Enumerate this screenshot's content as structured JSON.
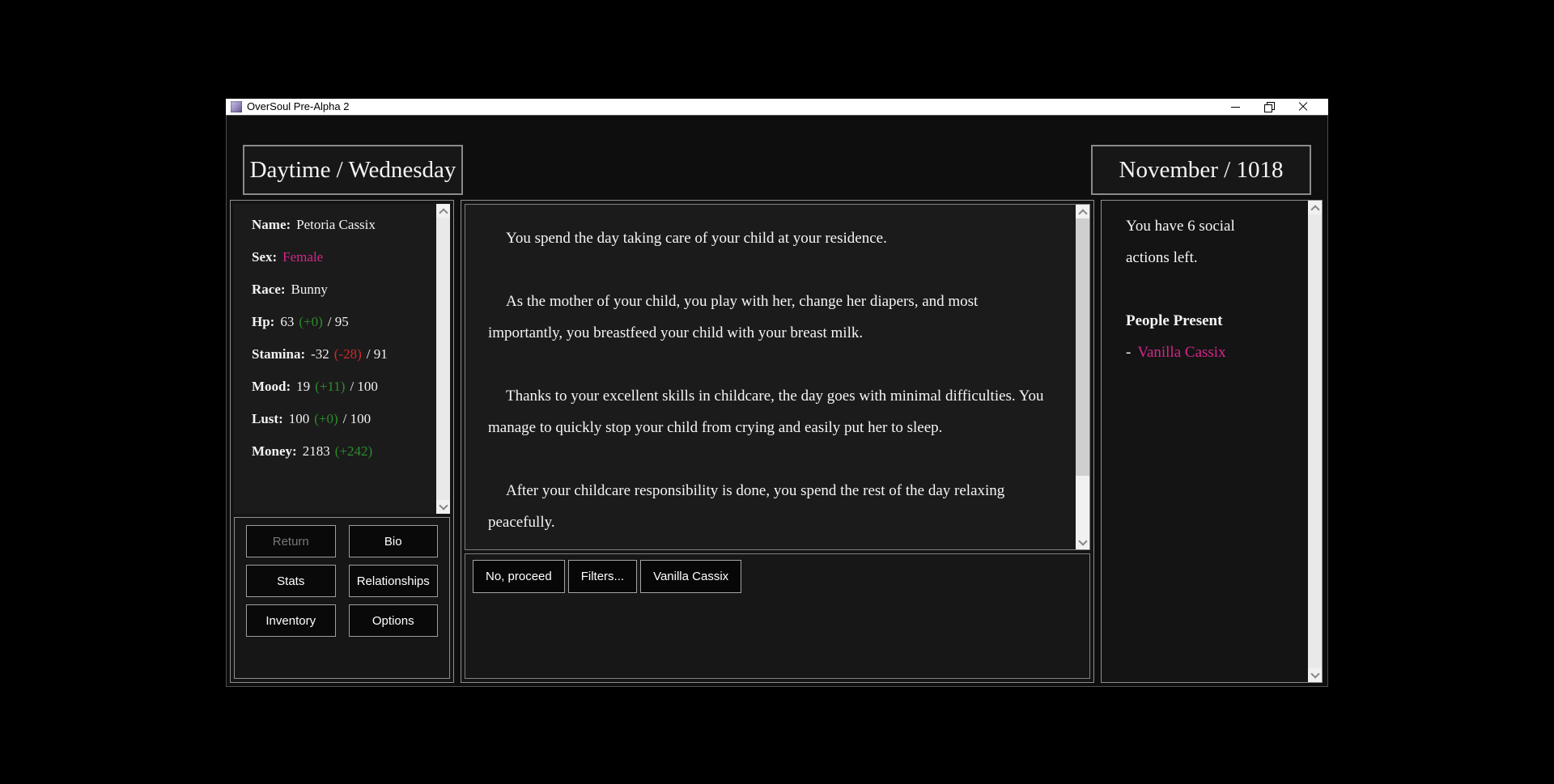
{
  "window": {
    "title": "OverSoul Pre-Alpha 2"
  },
  "header": {
    "daypart_weekday": "Daytime / Wednesday",
    "month_year": "November / 1018"
  },
  "colors": {
    "pink": "#d6258a",
    "green": "#2e8b2e",
    "red": "#cc2b2b",
    "disabled_gray": "#787878"
  },
  "stats": {
    "items": [
      {
        "label": "Name:",
        "value": "Petoria Cassix"
      },
      {
        "label": "Sex:",
        "value": "Female",
        "value_color": "#d6258a"
      },
      {
        "label": "Race:",
        "value": "Bunny"
      },
      {
        "label": "Hp:",
        "value": "63",
        "delta": "(+0)",
        "delta_color": "#2e8b2e",
        "suffix": "/ 95"
      },
      {
        "label": "Stamina:",
        "value": "-32",
        "delta": "(-28)",
        "delta_color": "#cc2b2b",
        "suffix": "/ 91"
      },
      {
        "label": "Mood:",
        "value": "19",
        "delta": "(+11)",
        "delta_color": "#2e8b2e",
        "suffix": "/ 100"
      },
      {
        "label": "Lust:",
        "value": "100",
        "delta": "(+0)",
        "delta_color": "#2e8b2e",
        "suffix": "/ 100"
      },
      {
        "label": "Money:",
        "value": "2183",
        "delta": "(+242)",
        "delta_color": "#2e8b2e",
        "suffix": ""
      }
    ]
  },
  "menu": {
    "buttons": [
      {
        "label": "Return",
        "disabled": true
      },
      {
        "label": "Bio",
        "disabled": false
      },
      {
        "label": "Stats",
        "disabled": false
      },
      {
        "label": "Relationships",
        "disabled": false
      },
      {
        "label": "Inventory",
        "disabled": false
      },
      {
        "label": "Options",
        "disabled": false
      }
    ]
  },
  "story": {
    "paragraphs": [
      "You spend the day taking care of your child at your residence.",
      "As the mother of your child, you play with her, change her diapers, and most importantly, you breastfeed your child with your breast milk.",
      "Thanks to your excellent skills in childcare, the day goes with minimal difficulties. You manage to quickly stop your child from crying and easily put her to sleep.",
      "After your childcare responsibility is done, you spend the rest of the day relaxing peacefully."
    ]
  },
  "choices": {
    "buttons": [
      "No, proceed",
      "Filters...",
      "Vanilla Cassix"
    ]
  },
  "social": {
    "text": "You have 6 social actions left.",
    "people_header": "People Present",
    "people": [
      {
        "prefix": "-",
        "name": "Vanilla Cassix",
        "name_color": "#d6258a"
      }
    ]
  }
}
